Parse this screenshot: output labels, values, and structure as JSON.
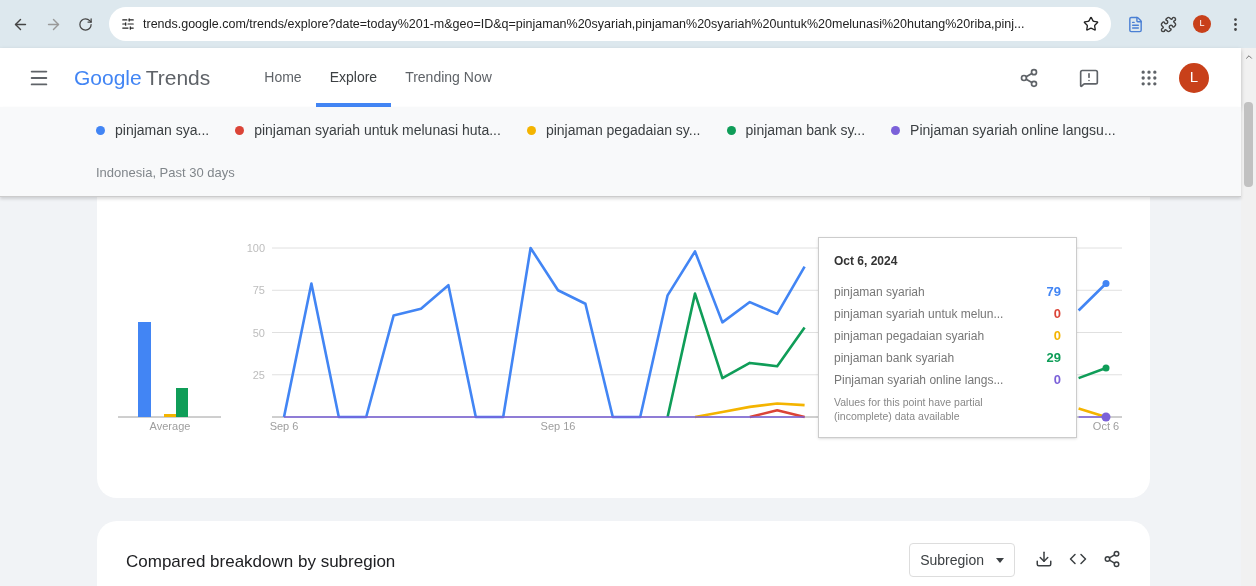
{
  "browser": {
    "url": "trends.google.com/trends/explore?date=today%201-m&geo=ID&q=pinjaman%20syariah,pinjaman%20syariah%20untuk%20melunasi%20hutang%20riba,pinj...",
    "avatar": "L"
  },
  "header": {
    "logo_google": "Google",
    "logo_trends": "Trends",
    "nav": [
      {
        "label": "Home",
        "selected": false
      },
      {
        "label": "Explore",
        "selected": true
      },
      {
        "label": "Trending Now",
        "selected": false
      }
    ],
    "avatar": "L"
  },
  "filter": "Indonesia, Past 30 days",
  "average_label": "Average",
  "chart_data": {
    "type": "line",
    "grid": true,
    "categories": [
      "Sep 6",
      null,
      null,
      null,
      null,
      null,
      null,
      null,
      null,
      null,
      "Sep 16",
      null,
      null,
      null,
      null,
      null,
      null,
      null,
      null,
      null,
      null,
      null,
      null,
      null,
      null,
      null,
      null,
      null,
      null,
      null,
      "Oct 6"
    ],
    "ylim": [
      0,
      100
    ],
    "yticks": [
      25,
      50,
      75,
      100
    ],
    "series": [
      {
        "name": "pinjaman sya...",
        "color": "#4285f4",
        "values": [
          0,
          79,
          0,
          0,
          60,
          64,
          78,
          0,
          0,
          100,
          75,
          67,
          0,
          0,
          72,
          98,
          56,
          68,
          61,
          89,
          null,
          null,
          null,
          null,
          null,
          null,
          null,
          null,
          null,
          63,
          79
        ]
      },
      {
        "name": "pinjaman syariah untuk melunasi huta...",
        "color": "#db4437",
        "values": [
          null,
          null,
          null,
          null,
          null,
          null,
          null,
          null,
          null,
          null,
          null,
          null,
          null,
          null,
          null,
          null,
          null,
          0,
          4,
          0,
          null,
          null,
          null,
          null,
          null,
          null,
          null,
          null,
          null,
          null,
          null
        ]
      },
      {
        "name": "pinjaman pegadaian sy...",
        "color": "#f4b400",
        "values": [
          null,
          null,
          null,
          null,
          null,
          null,
          null,
          null,
          null,
          null,
          null,
          null,
          null,
          null,
          null,
          0,
          3,
          6,
          8,
          7,
          null,
          null,
          null,
          null,
          null,
          null,
          null,
          null,
          null,
          5,
          0
        ]
      },
      {
        "name": "pinjaman bank sy...",
        "color": "#0f9d58",
        "values": [
          null,
          null,
          null,
          null,
          null,
          null,
          null,
          null,
          null,
          null,
          null,
          null,
          null,
          null,
          0,
          73,
          23,
          32,
          30,
          53,
          null,
          null,
          null,
          null,
          null,
          null,
          null,
          null,
          null,
          23,
          29
        ]
      },
      {
        "name": "Pinjaman syariah online langsu...",
        "color": "#7b61d9",
        "values": [
          0,
          0,
          0,
          0,
          0,
          0,
          0,
          0,
          0,
          0,
          0,
          0,
          0,
          0,
          0,
          0,
          0,
          0,
          0,
          0,
          null,
          null,
          null,
          null,
          null,
          null,
          null,
          null,
          null,
          0,
          0
        ]
      }
    ]
  },
  "tooltip": {
    "date": "Oct 6, 2024",
    "rows": [
      {
        "name": "pinjaman syariah",
        "value": "79",
        "color": "#4285f4"
      },
      {
        "name": "pinjaman syariah untuk melun...",
        "value": "0",
        "color": "#db4437"
      },
      {
        "name": "pinjaman pegadaian syariah",
        "value": "0",
        "color": "#f4b400"
      },
      {
        "name": "pinjaman bank syariah",
        "value": "29",
        "color": "#0f9d58"
      },
      {
        "name": "Pinjaman syariah online langs...",
        "value": "0",
        "color": "#7b61d9"
      }
    ],
    "note": "Values for this point have partial (incomplete) data available"
  },
  "breakdown": {
    "title": "Compared breakdown by subregion",
    "select": "Subregion"
  }
}
